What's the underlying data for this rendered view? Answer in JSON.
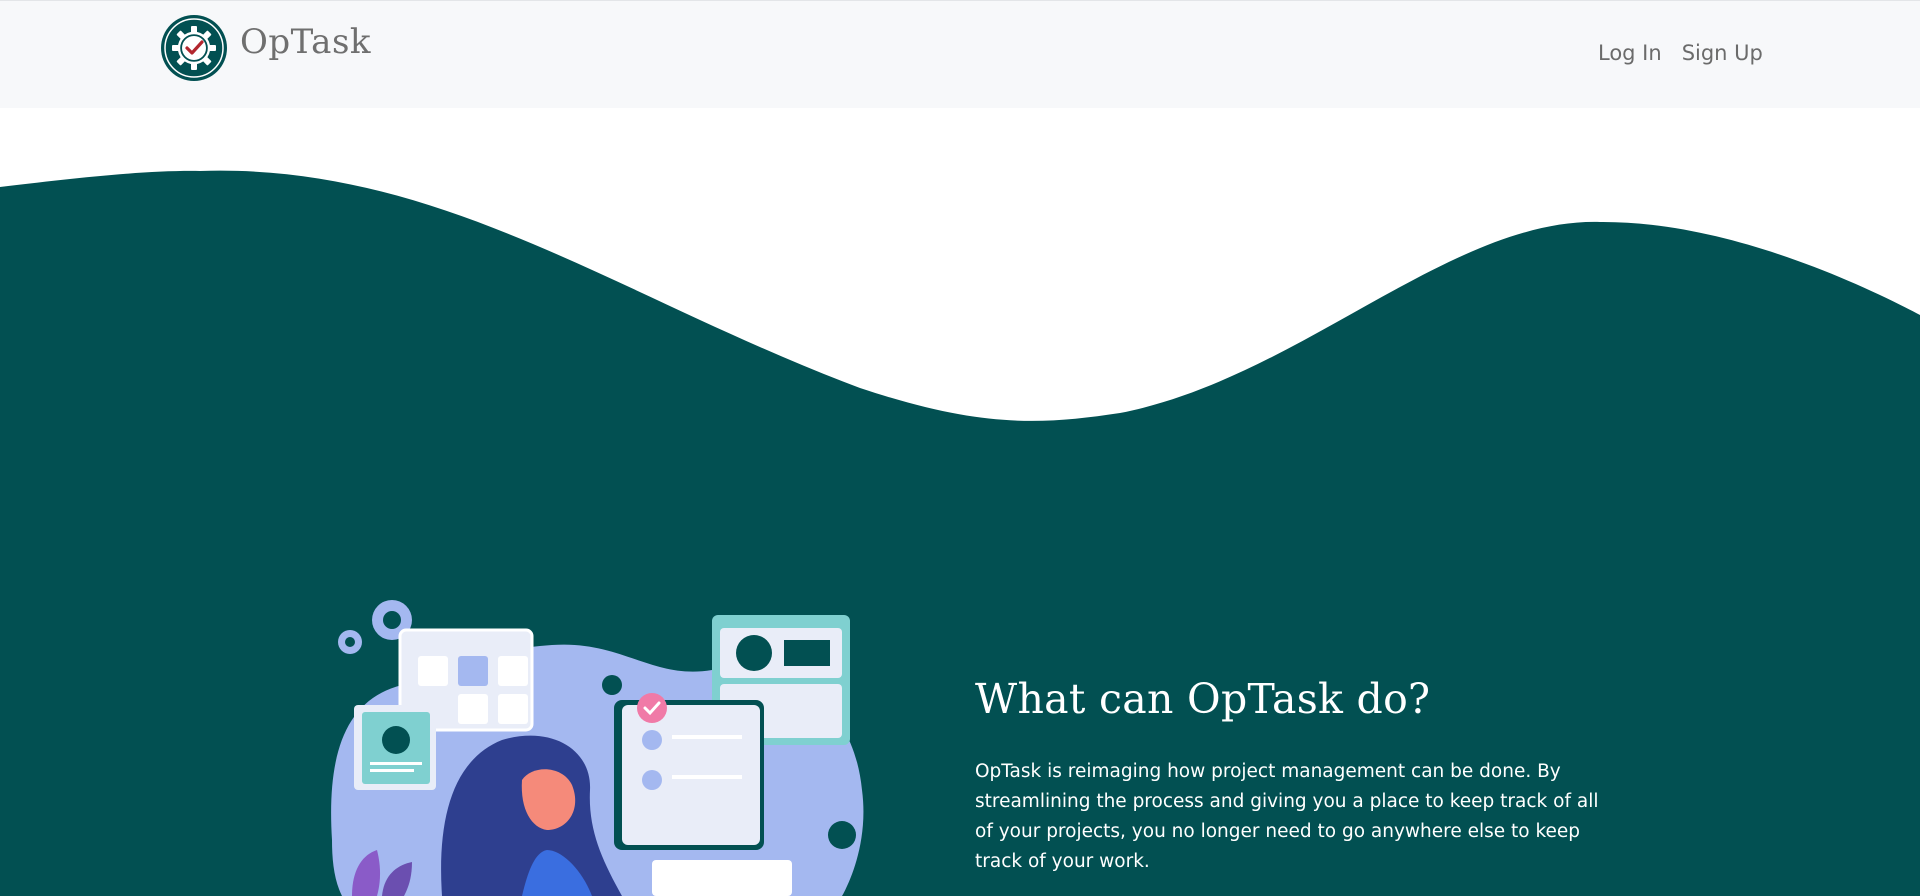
{
  "brand": {
    "name": "OpTask",
    "logo_icon": "gear-check-icon"
  },
  "nav": {
    "login_label": "Log In",
    "signup_label": "Sign Up"
  },
  "hero": {
    "heading": "What can OpTask do?",
    "description": "OpTask is reimaging how project management can be done. By streamlining the process and giving you a place to keep track of all of your projects, you no longer need to go anywhere else to keep track of your work."
  },
  "colors": {
    "primary": "#025052",
    "navbar_bg": "#f7f8fa",
    "nav_text": "#6b6b6b",
    "accent_pink": "#f07aa7",
    "illustration_blue": "#a4b8f0"
  }
}
